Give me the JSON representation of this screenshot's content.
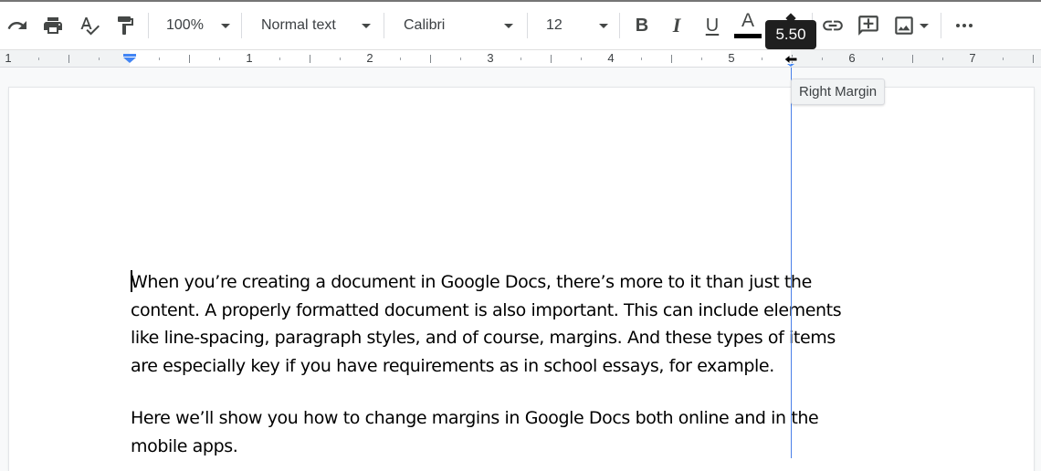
{
  "toolbar": {
    "zoom": "100%",
    "paragraph_style": "Normal text",
    "font": "Calibri",
    "font_size": "12",
    "bold_label": "B",
    "italic_label": "I",
    "underline_label": "U",
    "text_color_label": "A",
    "text_color": "#000000",
    "icons": [
      "redo-icon",
      "print-icon",
      "spellcheck-icon",
      "paint-format-icon",
      "bold-icon",
      "italic-icon",
      "underline-icon",
      "text-color-icon",
      "highlight-icon",
      "link-icon",
      "add-comment-icon",
      "insert-image-icon",
      "more-options-icon"
    ]
  },
  "ruler": {
    "labels": [
      "1",
      "1",
      "2",
      "3",
      "4",
      "5",
      "6",
      "7"
    ],
    "left_indent_inches": 0,
    "right_margin_inches": 5.5,
    "accent_color": "#4285f4"
  },
  "drag_tooltip": {
    "value": "5.50",
    "label": "Right Margin"
  },
  "document": {
    "paragraphs": [
      {
        "lines": [
          "When you’re creating a document in Google Docs, there’s more to it than just the",
          "content. A properly formatted document is also important. This can include elements",
          "like line-spacing, paragraph styles, and of course, margins. And these types of items",
          "are especially key if you have requirements as in school essays, for example."
        ]
      },
      {
        "lines": [
          "Here we’ll show you how to change margins in Google Docs both online and in the",
          "mobile apps."
        ]
      }
    ]
  }
}
